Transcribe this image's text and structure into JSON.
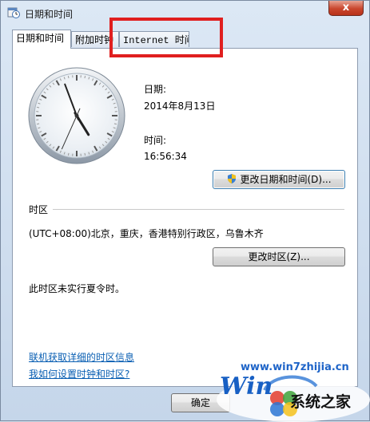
{
  "window": {
    "title": "日期和时间",
    "close_glyph": "x"
  },
  "tabs": [
    {
      "label": "日期和时间",
      "active": true
    },
    {
      "label": "附加时钟",
      "active": false
    },
    {
      "label": "Internet 时间",
      "active": false
    }
  ],
  "date_section": {
    "date_label": "日期:",
    "date_value": "2014年8月13日",
    "time_label": "时间:",
    "time_value": "16:56:34"
  },
  "clock": {
    "hour": 16,
    "minute": 56,
    "second": 34
  },
  "buttons": {
    "change_datetime": "更改日期和时间(D)...",
    "change_timezone": "更改时区(Z)...",
    "ok": "确定"
  },
  "timezone": {
    "header": "时区",
    "value": "(UTC+08:00)北京，重庆，香港特别行政区，乌鲁木齐",
    "dst_note": "此时区未实行夏令时。"
  },
  "links": {
    "tz_info": "联机获取详细的时区信息",
    "howto": "我如何设置时钟和时区?"
  },
  "watermark": {
    "url": "www.win7zhijia.cn",
    "win_text": "Win",
    "brand": "系统之家"
  },
  "colors": {
    "link": "#0a5fb3",
    "highlight": "#e01f1f",
    "watermark_blue": "#1e64c8"
  }
}
